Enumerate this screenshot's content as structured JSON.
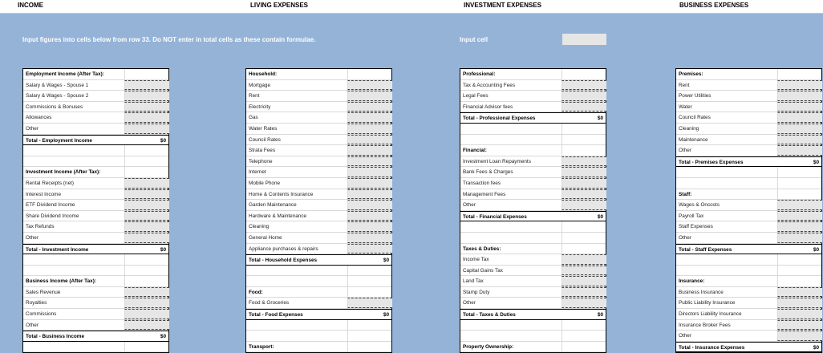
{
  "headers": [
    "INCOME",
    "LIVING EXPENSES",
    "INVESTMENT EXPENSES",
    "BUSINESS EXPENSES"
  ],
  "instruction": "Input figures into cells below from row 33. Do NOT enter in total cells as these contain formulae.",
  "input_cell_label": "Input cell",
  "colors": {
    "background": "#95b3d7",
    "input_cell": "#e6e6e6",
    "header_bg": "#ffffff",
    "instruction_text": "#ffffff"
  },
  "columns": [
    {
      "rows": [
        {
          "t": "h",
          "label": "Employment Income (After Tax):"
        },
        {
          "t": "i",
          "label": "Salary & Wages - Spouse 1"
        },
        {
          "t": "i",
          "label": "Salary & Wages - Spouse 2"
        },
        {
          "t": "i",
          "label": "Commissions & Bonuses"
        },
        {
          "t": "i",
          "label": "Allowances"
        },
        {
          "t": "i",
          "label": "Other"
        },
        {
          "t": "t",
          "label": "Total - Employment Income",
          "value": "$0"
        },
        {
          "t": "b"
        },
        {
          "t": "b"
        },
        {
          "t": "h",
          "label": "Investment Income (After Tax):"
        },
        {
          "t": "i",
          "label": "Rental Receipts (net)"
        },
        {
          "t": "i",
          "label": "Interest Income"
        },
        {
          "t": "i",
          "label": "ETF Dividend Income"
        },
        {
          "t": "i",
          "label": "Share Dividend Income"
        },
        {
          "t": "i",
          "label": "Tax Refunds"
        },
        {
          "t": "i",
          "label": "Other"
        },
        {
          "t": "t",
          "label": "Total - Investment Income",
          "value": "$0"
        },
        {
          "t": "b"
        },
        {
          "t": "b"
        },
        {
          "t": "h",
          "label": "Business Income (After Tax):"
        },
        {
          "t": "i",
          "label": "Sales Revenue"
        },
        {
          "t": "i",
          "label": "Royalties"
        },
        {
          "t": "i",
          "label": "Commissions"
        },
        {
          "t": "i",
          "label": "Other"
        },
        {
          "t": "t",
          "label": "Total - Business Income",
          "value": "$0"
        },
        {
          "t": "b"
        }
      ]
    },
    {
      "rows": [
        {
          "t": "h",
          "label": "Household:"
        },
        {
          "t": "i",
          "label": "Mortgage"
        },
        {
          "t": "i",
          "label": "Rent"
        },
        {
          "t": "i",
          "label": "Electricity"
        },
        {
          "t": "i",
          "label": "Gas"
        },
        {
          "t": "i",
          "label": "Water Rates"
        },
        {
          "t": "i",
          "label": "Council Rates"
        },
        {
          "t": "i",
          "label": "Strata Fees"
        },
        {
          "t": "i",
          "label": "Telephone"
        },
        {
          "t": "i",
          "label": "Internet"
        },
        {
          "t": "i",
          "label": "Mobile Phone"
        },
        {
          "t": "i",
          "label": "Home & Contents Insurance"
        },
        {
          "t": "i",
          "label": "Garden Maintenance"
        },
        {
          "t": "i",
          "label": "Hardware & Maintenance"
        },
        {
          "t": "i",
          "label": "Cleaning"
        },
        {
          "t": "i",
          "label": "General Home"
        },
        {
          "t": "i",
          "label": "Appliance purchases & repairs"
        },
        {
          "t": "t",
          "label": "Total - Household Expenses",
          "value": "$0"
        },
        {
          "t": "b"
        },
        {
          "t": "b"
        },
        {
          "t": "h",
          "label": "Food:"
        },
        {
          "t": "i",
          "label": "Food & Groceries"
        },
        {
          "t": "t",
          "label": "Total - Food Expenses",
          "value": "$0"
        },
        {
          "t": "b"
        },
        {
          "t": "b"
        },
        {
          "t": "h",
          "label": "Transport:"
        }
      ]
    },
    {
      "rows": [
        {
          "t": "h",
          "label": "Professional:"
        },
        {
          "t": "i",
          "label": "Tax & Accounting Fees"
        },
        {
          "t": "i",
          "label": "Legal Fees"
        },
        {
          "t": "i",
          "label": "Financial Advisor fees"
        },
        {
          "t": "t",
          "label": "Total - Professional Expenses",
          "value": "$0"
        },
        {
          "t": "b"
        },
        {
          "t": "b"
        },
        {
          "t": "h",
          "label": "Financial:"
        },
        {
          "t": "i",
          "label": "Investment Loan Repayments"
        },
        {
          "t": "i",
          "label": "Bank Fees & Charges"
        },
        {
          "t": "i",
          "label": "Transaction fees"
        },
        {
          "t": "i",
          "label": "Management Fees"
        },
        {
          "t": "i",
          "label": "Other"
        },
        {
          "t": "t",
          "label": "Total - Financial Expenses",
          "value": "$0"
        },
        {
          "t": "b"
        },
        {
          "t": "b"
        },
        {
          "t": "h",
          "label": "Taxes & Duties:"
        },
        {
          "t": "i",
          "label": "Income Tax"
        },
        {
          "t": "i",
          "label": "Capital Gains Tax"
        },
        {
          "t": "i",
          "label": "Land Tax"
        },
        {
          "t": "i",
          "label": "Stamp Duty"
        },
        {
          "t": "i",
          "label": "Other"
        },
        {
          "t": "t",
          "label": "Total - Taxes & Duties",
          "value": "$0"
        },
        {
          "t": "b"
        },
        {
          "t": "b"
        },
        {
          "t": "h",
          "label": "Property Ownership:"
        }
      ]
    },
    {
      "rows": [
        {
          "t": "h",
          "label": "Premises:"
        },
        {
          "t": "i",
          "label": "Rent"
        },
        {
          "t": "i",
          "label": "Power Utilities"
        },
        {
          "t": "i",
          "label": "Water"
        },
        {
          "t": "i",
          "label": "Council Rates"
        },
        {
          "t": "i",
          "label": "Cleaning"
        },
        {
          "t": "i",
          "label": "Maintenance"
        },
        {
          "t": "i",
          "label": "Other"
        },
        {
          "t": "t",
          "label": "Total - Premises Expenses",
          "value": "$0"
        },
        {
          "t": "b"
        },
        {
          "t": "b"
        },
        {
          "t": "h",
          "label": "Staff:"
        },
        {
          "t": "i",
          "label": "Wages & Oncosts"
        },
        {
          "t": "i",
          "label": "Payroll Tax"
        },
        {
          "t": "i",
          "label": "Staff Expenses"
        },
        {
          "t": "i",
          "label": "Other"
        },
        {
          "t": "t",
          "label": "Total - Staff Expenses",
          "value": "$0"
        },
        {
          "t": "b"
        },
        {
          "t": "b"
        },
        {
          "t": "h",
          "label": "Insurance:"
        },
        {
          "t": "i",
          "label": "Business Insurance"
        },
        {
          "t": "i",
          "label": "Public Liability Insurance"
        },
        {
          "t": "i",
          "label": "Directors Liability Insurance"
        },
        {
          "t": "i",
          "label": "Insurance Broker Fees"
        },
        {
          "t": "i",
          "label": "Other"
        },
        {
          "t": "t",
          "label": "Total - Insurance Expenses",
          "value": "$0"
        }
      ]
    }
  ]
}
